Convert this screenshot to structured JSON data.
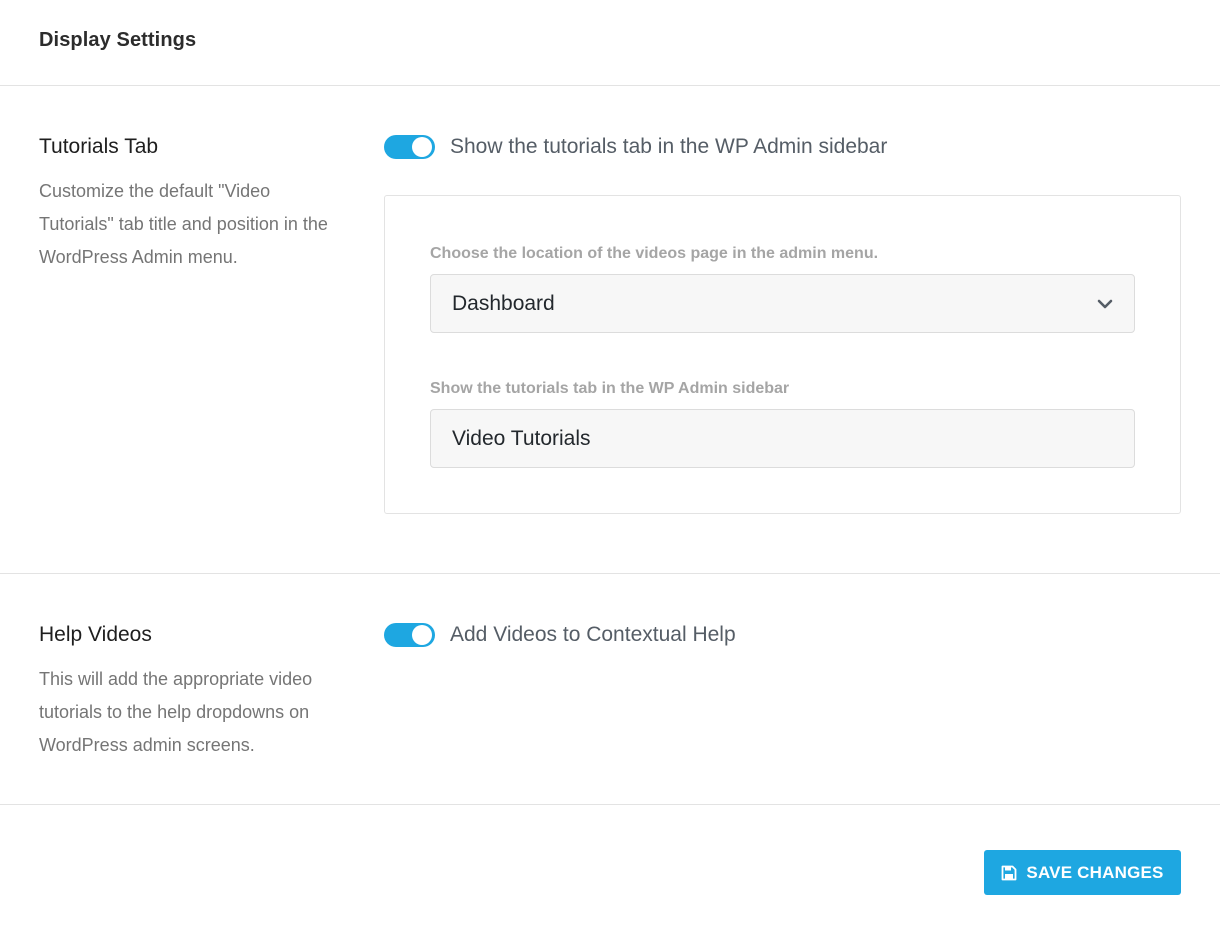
{
  "header": {
    "title": "Display Settings"
  },
  "tutorials": {
    "title": "Tutorials Tab",
    "description": "Customize the default \"Video Tutorials\" tab title and position in the WordPress Admin menu.",
    "toggle_label": "Show the tutorials tab in the WP Admin sidebar",
    "toggle_on": true,
    "location_label": "Choose the location of the videos page in the admin menu.",
    "location_value": "Dashboard",
    "tab_title_label": "Show the tutorials tab in the WP Admin sidebar",
    "tab_title_value": "Video Tutorials"
  },
  "help": {
    "title": "Help Videos",
    "description": "This will add the appropriate video tutorials to the help dropdowns on WordPress admin screens.",
    "toggle_label": "Add Videos to Contextual Help",
    "toggle_on": true
  },
  "footer": {
    "save_label": "SAVE CHANGES"
  },
  "colors": {
    "accent": "#1ea7e1",
    "border": "#e3e3e3",
    "muted_text": "#757575"
  },
  "icons": {
    "select": "chevron-down-icon",
    "save": "floppy-disk-icon"
  }
}
